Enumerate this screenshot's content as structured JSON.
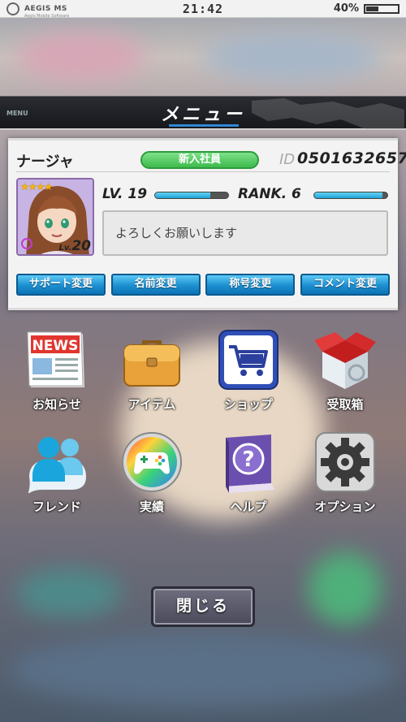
{
  "status_bar": {
    "brand": "AEGIS MS",
    "brand_sub": "Aegis Mobile Software",
    "time": "21:42",
    "battery": "40%",
    "battery_level": 0.4
  },
  "header": {
    "menu_en": "MENU",
    "title": "メニュー"
  },
  "profile": {
    "name": "ナージャ",
    "title_badge": "新入社員",
    "id_label": "ID",
    "id_value": "0501632657",
    "stars": "★★★★",
    "avatar_level_prefix": "Lv.",
    "avatar_level": "20",
    "level_label": "LV. 19",
    "level_progress": 0.75,
    "rank_label": "RANK. 6",
    "rank_progress": 0.93,
    "comment": "よろしくお願いします",
    "buttons": [
      "サポート変更",
      "名前変更",
      "称号変更",
      "コメント変更"
    ]
  },
  "menu_items": [
    {
      "label": "お知らせ",
      "icon": "news-icon"
    },
    {
      "label": "アイテム",
      "icon": "briefcase-icon"
    },
    {
      "label": "ショップ",
      "icon": "shopping-cart-icon"
    },
    {
      "label": "受取箱",
      "icon": "gift-box-icon"
    },
    {
      "label": "フレンド",
      "icon": "friends-icon"
    },
    {
      "label": "実績",
      "icon": "gamepad-icon"
    },
    {
      "label": "ヘルプ",
      "icon": "help-book-icon"
    },
    {
      "label": "オプション",
      "icon": "gear-icon"
    }
  ],
  "news_icon_text": "NEWS",
  "close_label": "閉じる"
}
